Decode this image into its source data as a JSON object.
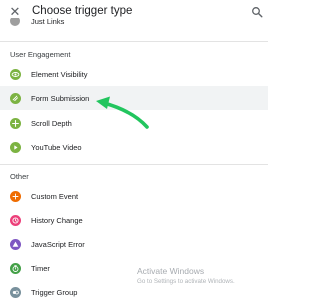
{
  "header": {
    "title": "Choose trigger type",
    "close_icon": "close-icon",
    "search_icon": "search-icon"
  },
  "partial_item": {
    "label": "Just Links"
  },
  "sections": [
    {
      "heading": "User Engagement",
      "items": [
        {
          "label": "Element Visibility",
          "icon": "eye-icon",
          "color": "#7cb342"
        },
        {
          "label": "Form Submission",
          "icon": "form-icon",
          "color": "#7cb342",
          "selected": true
        },
        {
          "label": "Scroll Depth",
          "icon": "scroll-icon",
          "color": "#7cb342"
        },
        {
          "label": "YouTube Video",
          "icon": "play-icon",
          "color": "#7cb342"
        }
      ]
    },
    {
      "heading": "Other",
      "items": [
        {
          "label": "Custom Event",
          "icon": "custom-event-icon",
          "color": "#ef6c00"
        },
        {
          "label": "History Change",
          "icon": "history-icon",
          "color": "#ec407a"
        },
        {
          "label": "JavaScript Error",
          "icon": "warning-icon",
          "color": "#7e57c2"
        },
        {
          "label": "Timer",
          "icon": "timer-icon",
          "color": "#43a047"
        },
        {
          "label": "Trigger Group",
          "icon": "group-icon",
          "color": "#78909c"
        }
      ]
    }
  ],
  "watermark": {
    "title": "Activate Windows",
    "subtitle": "Go to Settings to activate Windows."
  },
  "colors": {
    "accent": "#22c55e",
    "selected_row": "#f1f3f4"
  }
}
